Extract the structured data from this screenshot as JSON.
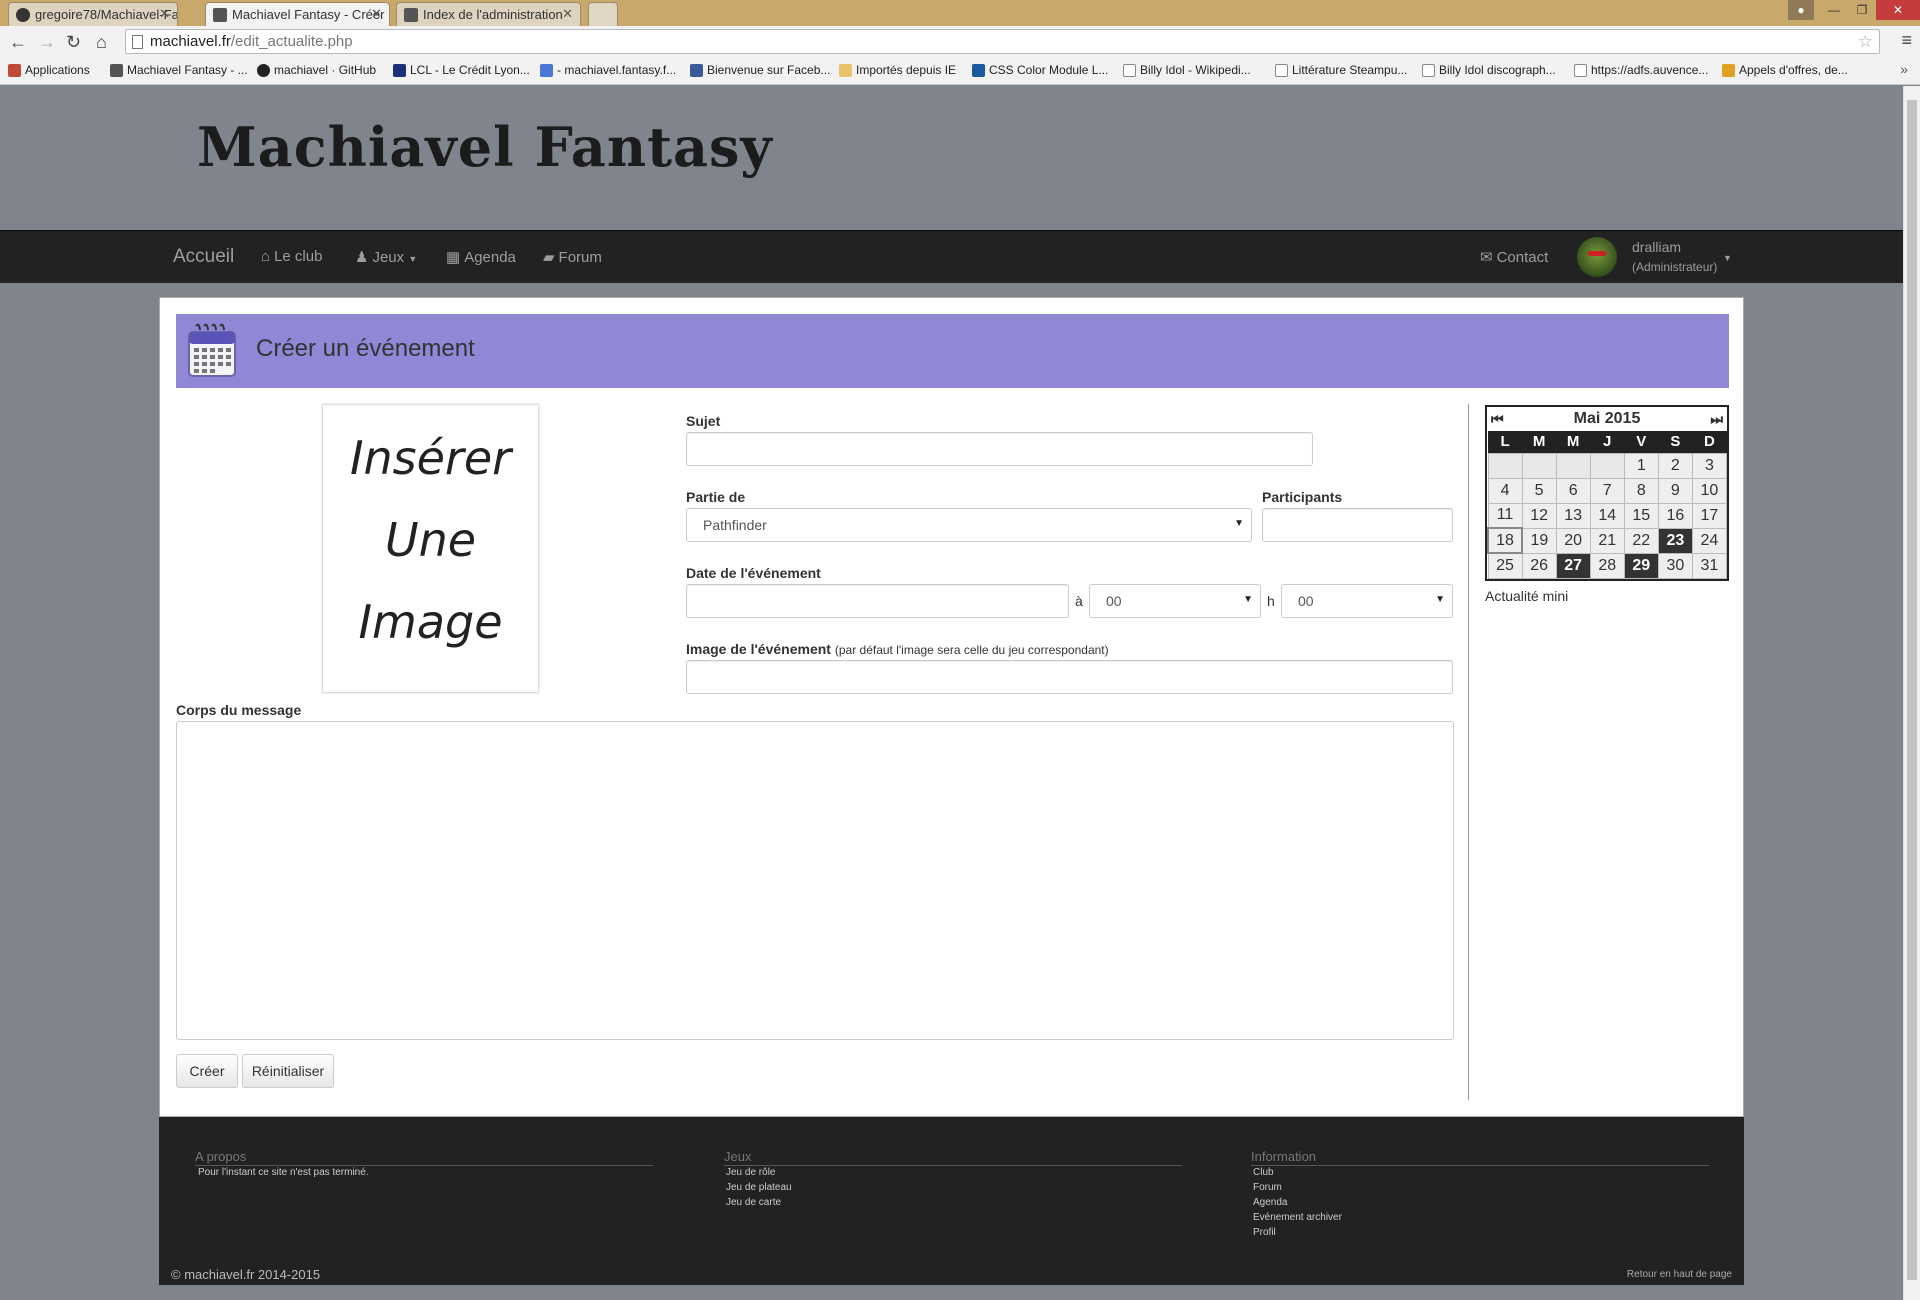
{
  "browser": {
    "tabs": [
      {
        "title": "gregoire78/Machiavel-Fa"
      },
      {
        "title": "Machiavel Fantasy - Créer"
      },
      {
        "title": "Index de l'administration"
      }
    ],
    "url_domain": "machiavel.fr",
    "url_path": "/edit_actualite.php",
    "bookmarks": [
      "Applications",
      "Machiavel Fantasy - ...",
      "machiavel · GitHub",
      "LCL - Le Crédit Lyon...",
      "- machiavel.fantasy.f...",
      "Bienvenue sur Faceb...",
      "Importés depuis IE",
      "CSS Color Module L...",
      "Billy Idol - Wikipedi...",
      "Littérature Steampu...",
      "Billy Idol discograph...",
      "https://adfs.auvence...",
      "Appels d'offres, de..."
    ]
  },
  "site": {
    "logo": "Machiavel Fantasy",
    "nav": {
      "home": "Accueil",
      "club": "Le club",
      "games": "Jeux",
      "agenda": "Agenda",
      "forum": "Forum",
      "contact": "Contact"
    },
    "user": {
      "name": "dralliam",
      "role": "(Administrateur)"
    }
  },
  "page": {
    "title": "Créer un événement",
    "image_placeholder": [
      "Insérer",
      "Une",
      "Image"
    ],
    "form": {
      "subject_label": "Sujet",
      "subject_value": "",
      "part_of_label": "Partie de",
      "part_of_value": "Pathfinder",
      "participants_label": "Participants",
      "participants_value": "",
      "date_label": "Date de l'événement",
      "date_value": "",
      "at": "à",
      "hour_value": "00",
      "h": "h",
      "minute_value": "00",
      "image_label": "Image de l'événement",
      "image_hint": "(par défaut l'image sera celle du jeu correspondant)",
      "image_value": "",
      "body_label": "Corps du message",
      "body_value": "",
      "create_button": "Créer",
      "reset_button": "Réinitialiser"
    },
    "calendar": {
      "month": "Mai 2015",
      "weekdays": [
        "L",
        "M",
        "M",
        "J",
        "V",
        "S",
        "D"
      ],
      "weeks": [
        [
          "",
          "",
          "",
          "",
          "1",
          "2",
          "3"
        ],
        [
          "4",
          "5",
          "6",
          "7",
          "8",
          "9",
          "10"
        ],
        [
          "11",
          "12",
          "13",
          "14",
          "15",
          "16",
          "17"
        ],
        [
          "18",
          "19",
          "20",
          "21",
          "22",
          "23",
          "24"
        ],
        [
          "25",
          "26",
          "27",
          "28",
          "29",
          "30",
          "31"
        ]
      ],
      "highlighted": [
        "23",
        "27",
        "29"
      ],
      "today": "18",
      "caption": "Actualité mini"
    }
  },
  "footer": {
    "about_title": "A propos",
    "about_text": "Pour l'instant ce site n'est pas terminé.",
    "games_title": "Jeux",
    "games_links": [
      "Jeu de rôle",
      "Jeu de plateau",
      "Jeu de carte"
    ],
    "info_title": "Information",
    "info_links": [
      "Club",
      "Forum",
      "Agenda",
      "Evénement archiver",
      "Profil"
    ],
    "copyright": "© machiavel.fr 2014-2015",
    "back_to_top": "Retour en haut de page"
  },
  "colors": {
    "page_bg": "#80848c",
    "title_bar": "#9087d6",
    "navbar": "#222222",
    "tab_strip": "#c9a96b"
  }
}
